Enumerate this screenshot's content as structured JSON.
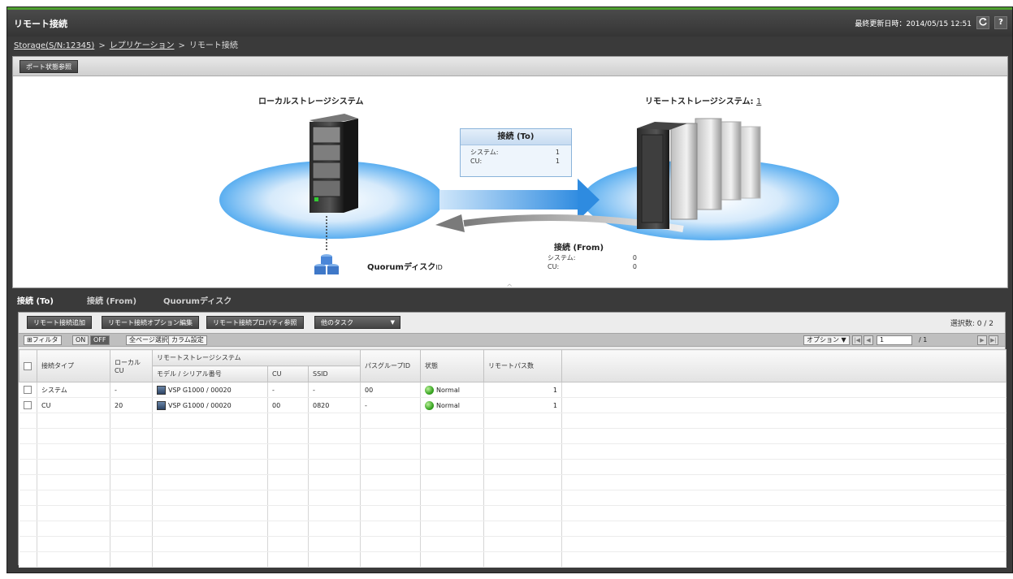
{
  "window": {
    "title": "リモート接続",
    "last_updated": "最終更新日時：2014/05/15 12:51",
    "refresh_icon": "refresh-icon",
    "help_icon": "help-icon",
    "help_label": "?"
  },
  "breadcrumb": {
    "storage": "Storage(S/N:12345)",
    "replication": "レプリケーション",
    "current": "リモート接続",
    "separator": ">"
  },
  "diagram": {
    "port_status_button": "ポート状態参照",
    "local_title": "ローカルストレージシステム",
    "remote_title": "リモートストレージシステム:",
    "remote_count": "1",
    "connection_to": {
      "title": "接続 (To)",
      "system_label": "システム:",
      "system_value": "1",
      "cu_label": "CU:",
      "cu_value": "1"
    },
    "connection_from": {
      "title": "接続 (From)",
      "system_label": "システム:",
      "system_value": "0",
      "cu_label": "CU:",
      "cu_value": "0"
    },
    "quorum_label": "Quorumディスク",
    "quorum_id_label": "ID",
    "collapse_icon": "collapse-caret-icon",
    "collapse_glyph": "^"
  },
  "tabs": [
    "接続 (To)",
    "接続 (From)",
    "Quorumディスク"
  ],
  "toolbar": {
    "add_connection": "リモート接続追加",
    "edit_options": "リモート接続オプション編集",
    "view_properties": "リモート接続プロパティ参照",
    "other_tasks": "他のタスク",
    "selected_label": "選択数:",
    "selected_value": "0",
    "count_separator": "/",
    "total": "2"
  },
  "filterbar": {
    "filter_label": "フィルタ",
    "on_label": "ON",
    "off_label": "OFF",
    "select_all_pages": "全ページ選択",
    "column_settings": "カラム設定",
    "options": "オプション",
    "page_value": "1",
    "page_total": "/ 1"
  },
  "table": {
    "headers": {
      "connection_type": "接続タイプ",
      "local_cu": "ローカルCU",
      "remote_group": "リモートストレージシステム",
      "model_serial": "モデル / シリアル番号",
      "cu": "CU",
      "ssid": "SSID",
      "path_group_id": "パスグループID",
      "status": "状態",
      "remote_paths": "リモートパス数"
    },
    "rows": [
      {
        "connection_type": "システム",
        "local_cu": "-",
        "model_serial": "VSP G1000 / 00020",
        "cu": "-",
        "ssid": "-",
        "path_group_id": "00",
        "status": "Normal",
        "remote_paths": "1"
      },
      {
        "connection_type": "CU",
        "local_cu": "20",
        "model_serial": "VSP G1000 / 00020",
        "cu": "00",
        "ssid": "0820",
        "path_group_id": "-",
        "status": "Normal",
        "remote_paths": "1"
      }
    ]
  },
  "colors": {
    "accent": "#4e9f2f",
    "status_normal": "#3aa623",
    "arrow_blue": "#2e8be0"
  }
}
